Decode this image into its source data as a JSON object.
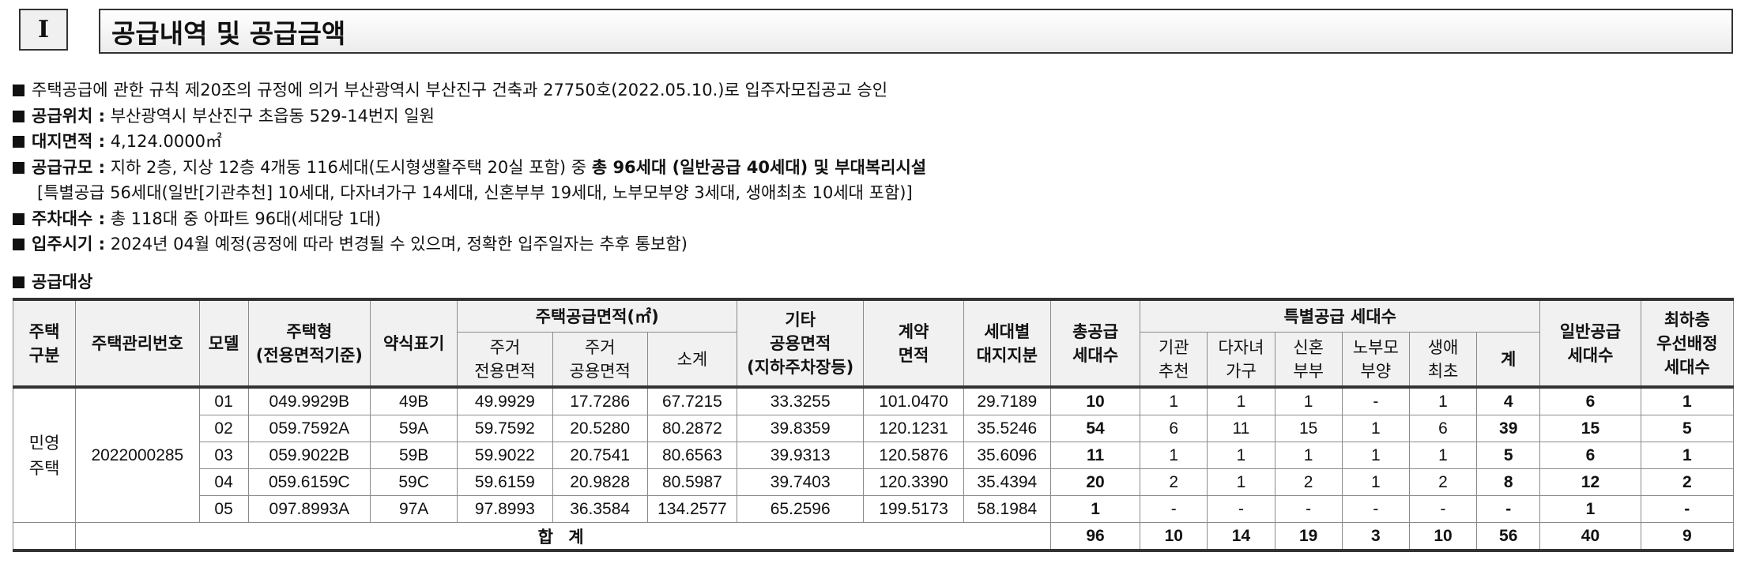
{
  "section": {
    "number": "I",
    "title": "공급내역 및 공급금액"
  },
  "info": {
    "approval": "주택공급에 관한 규칙 제20조의 규정에 의거 부산광역시 부산진구 건축과 27750호(2022.05.10.)로 입주자모집공고 승인",
    "location": {
      "label": "공급위치 :",
      "value": "부산광역시 부산진구 초읍동 529-14번지 일원"
    },
    "site_area": {
      "label": "대지면적 :",
      "value": "4,124.0000㎡"
    },
    "scale": {
      "label": "공급규모 :",
      "value": "지하 2층, 지상 12층 4개동 116세대(도시형생활주택 20실 포함) 중",
      "bold": "총 96세대 (일반공급 40세대) 및 부대복리시설",
      "detail": "[특별공급 56세대(일반[기관추천] 10세대, 다자녀가구 14세대, 신혼부부 19세대, 노부모부양 3세대, 생애최초 10세대 포함)]"
    },
    "parking": {
      "label": "주차대수 :",
      "value": "총 118대 중 아파트 96대(세대당 1대)"
    },
    "move_in": {
      "label": "입주시기 :",
      "value": "2024년 04월 예정(공정에 따라 변경될 수 있으며, 정확한 입주일자는 추후 통보함)"
    }
  },
  "table_heading": "공급대상",
  "table": {
    "headers": {
      "housing_type": "주택\n구분",
      "mgmt_no": "주택관리번호",
      "model": "모델",
      "house_type": "주택형\n(전용면적기준)",
      "abbr": "약식표기",
      "supply_area_group": "주택공급면적(㎡)",
      "exclusive": "주거\n전용면적",
      "common": "주거\n공용면적",
      "subtotal": "소계",
      "other_common": "기타\n공용면적\n(지하주차장등)",
      "contract_area": "계약\n면적",
      "land_share": "세대별\n대지지분",
      "total_supply": "총공급\n세대수",
      "special_group": "특별공급 세대수",
      "institution": "기관\n추천",
      "multi_child": "다자녀\n가구",
      "newlywed": "신혼\n부부",
      "elderly": "노부모\n부양",
      "first_time": "생애\n최초",
      "special_sum": "계",
      "general": "일반공급\n세대수",
      "lowest_floor": "최하층\n우선배정\n세대수"
    },
    "housing_type_value": "민영\n주택",
    "mgmt_no_value": "2022000285",
    "rows": [
      {
        "model": "01",
        "house_type": "049.9929B",
        "abbr": "49B",
        "exclusive": "49.9929",
        "common": "17.7286",
        "subtotal": "67.7215",
        "other": "33.3255",
        "contract": "101.0470",
        "land": "29.7189",
        "total": "10",
        "inst": "1",
        "multi": "1",
        "newly": "1",
        "elder": "-",
        "first": "1",
        "sum": "4",
        "general": "6",
        "lowest": "1"
      },
      {
        "model": "02",
        "house_type": "059.7592A",
        "abbr": "59A",
        "exclusive": "59.7592",
        "common": "20.5280",
        "subtotal": "80.2872",
        "other": "39.8359",
        "contract": "120.1231",
        "land": "35.5246",
        "total": "54",
        "inst": "6",
        "multi": "11",
        "newly": "15",
        "elder": "1",
        "first": "6",
        "sum": "39",
        "general": "15",
        "lowest": "5"
      },
      {
        "model": "03",
        "house_type": "059.9022B",
        "abbr": "59B",
        "exclusive": "59.9022",
        "common": "20.7541",
        "subtotal": "80.6563",
        "other": "39.9313",
        "contract": "120.5876",
        "land": "35.6096",
        "total": "11",
        "inst": "1",
        "multi": "1",
        "newly": "1",
        "elder": "1",
        "first": "1",
        "sum": "5",
        "general": "6",
        "lowest": "1"
      },
      {
        "model": "04",
        "house_type": "059.6159C",
        "abbr": "59C",
        "exclusive": "59.6159",
        "common": "20.9828",
        "subtotal": "80.5987",
        "other": "39.7403",
        "contract": "120.3390",
        "land": "35.4394",
        "total": "20",
        "inst": "2",
        "multi": "1",
        "newly": "2",
        "elder": "1",
        "first": "2",
        "sum": "8",
        "general": "12",
        "lowest": "2"
      },
      {
        "model": "05",
        "house_type": "097.8993A",
        "abbr": "97A",
        "exclusive": "97.8993",
        "common": "36.3584",
        "subtotal": "134.2577",
        "other": "65.2596",
        "contract": "199.5173",
        "land": "58.1984",
        "total": "1",
        "inst": "-",
        "multi": "-",
        "newly": "-",
        "elder": "-",
        "first": "-",
        "sum": "-",
        "general": "1",
        "lowest": "-"
      }
    ],
    "total_row": {
      "label": "합 계",
      "total": "96",
      "inst": "10",
      "multi": "14",
      "newly": "19",
      "elder": "3",
      "first": "10",
      "sum": "56",
      "general": "40",
      "lowest": "9"
    }
  }
}
